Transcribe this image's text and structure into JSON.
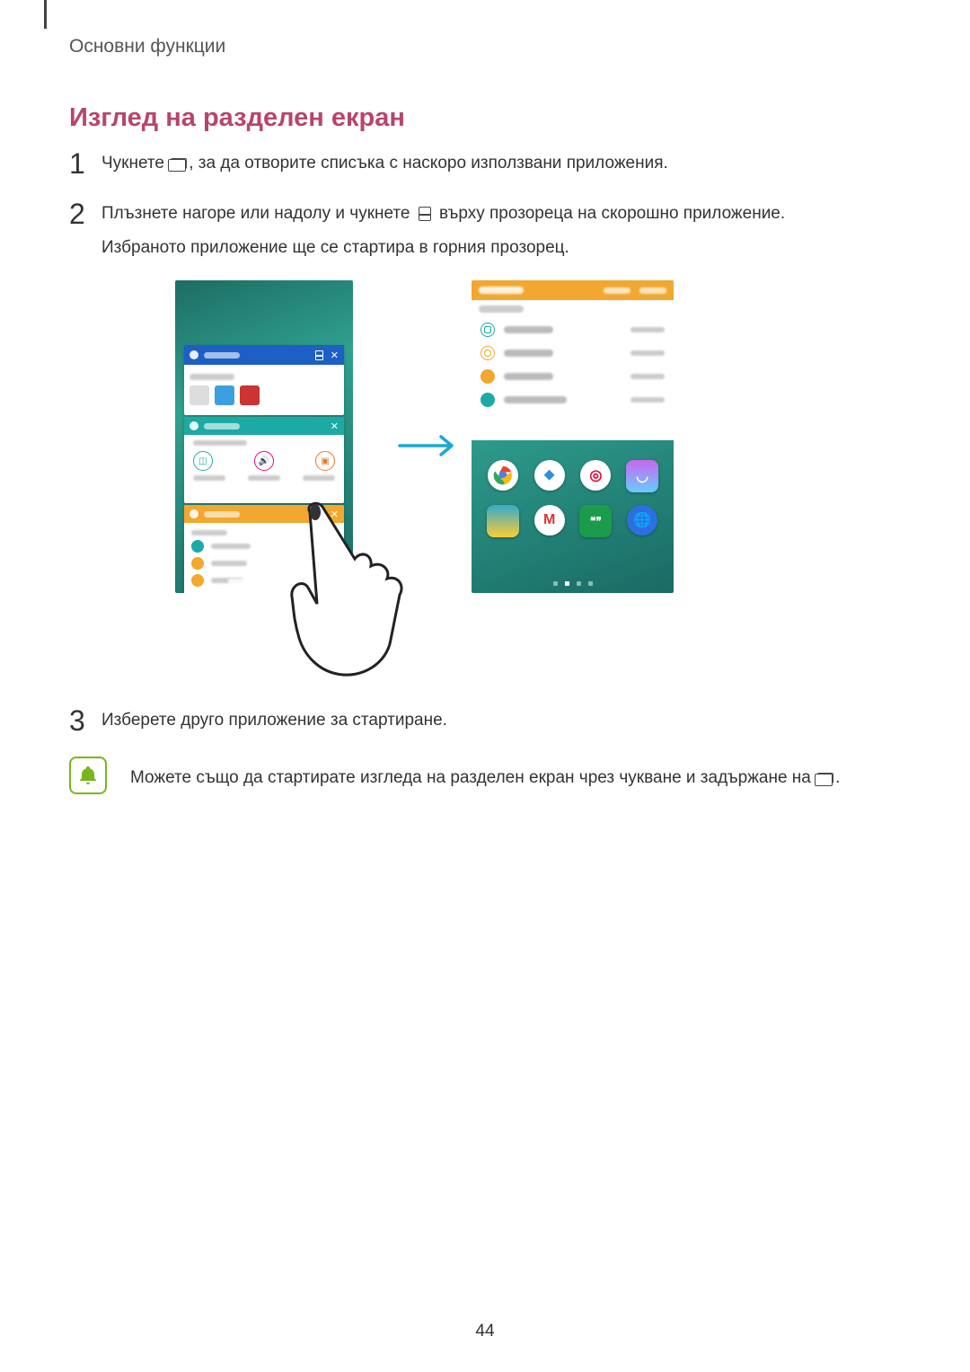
{
  "header": "Основни функции",
  "title": "Изглед на разделен екран",
  "steps": {
    "s1": {
      "num": "1",
      "pre": "Чукнете ",
      "post": ", за да отворите списъка с наскоро използвани приложения."
    },
    "s2": {
      "num": "2",
      "pre": "Плъзнете нагоре или надолу и чукнете ",
      "mid": " върху прозореца на скорошно приложение.",
      "line2": "Избраното приложение ще се стартира в горния прозорец."
    },
    "s3": {
      "num": "3",
      "text": "Изберете друго приложение за стартиране."
    }
  },
  "tip": {
    "pre": "Можете също да стартирате изгледа на разделен екран чрез чукване и задържане на ",
    "post": "."
  },
  "page_number": "44"
}
